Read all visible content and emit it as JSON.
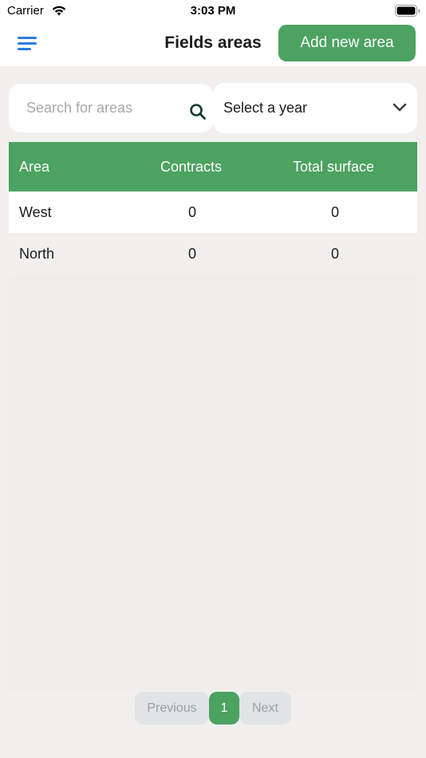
{
  "status_bar": {
    "carrier": "Carrier",
    "time": "3:03 PM"
  },
  "header": {
    "title": "Fields areas",
    "add_button_label": "Add new area",
    "menu_icon": "hamburger-menu-icon"
  },
  "search": {
    "placeholder": "Search for areas",
    "value": "",
    "icon": "search-icon"
  },
  "year_select": {
    "label": "Select a year",
    "icon": "chevron-down-icon"
  },
  "table": {
    "columns": [
      "Area",
      "Contracts",
      "Total surface"
    ],
    "rows": [
      {
        "area": "West",
        "contracts": "0",
        "total_surface": "0"
      },
      {
        "area": "North",
        "contracts": "0",
        "total_surface": "0"
      }
    ]
  },
  "pagination": {
    "previous_label": "Previous",
    "current_page": "1",
    "next_label": "Next"
  },
  "colors": {
    "accent_green": "#4ca260",
    "menu_blue": "#2a7de1",
    "background": "#f1f0ee"
  }
}
